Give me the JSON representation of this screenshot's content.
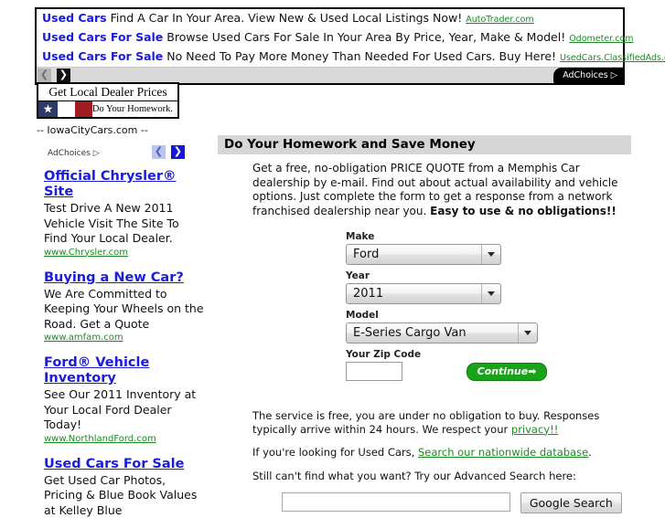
{
  "top_ads": {
    "lines": [
      {
        "title": "Used Cars",
        "text": "Find A Car In Your Area. View New & Used Local Listings Now!",
        "url": "AutoTrader.com"
      },
      {
        "title": "Used Cars For Sale",
        "text": "Browse Used Cars For Sale In Your Area By Price, Year, Make & Model!",
        "url": "Odometer.com"
      },
      {
        "title": "Used Cars For Sale",
        "text": "No Need To Pay More Money Than Needed For Used Cars. Buy Here!",
        "url": "UsedCars.ClassifiedAds.com"
      }
    ],
    "prev_label": "❮",
    "next_label": "❯",
    "adchoices_label": "AdChoices ▷"
  },
  "sidebar": {
    "banner": {
      "title": "Get Local Dealer Prices",
      "tagline": "Do Your Homework.",
      "star": "★"
    },
    "site_name": "-- IowaCityCars.com --",
    "adchoices_label": "AdChoices ▷",
    "prev_label": "❮",
    "next_label": "❯",
    "ads": [
      {
        "title": "Official Chrysler® Site",
        "desc": "Test Drive A New 2011 Vehicle Visit The Site To Find Your Local Dealer.",
        "url": "www.Chrysler.com"
      },
      {
        "title": "Buying a New Car?",
        "desc": "We Are Committed to Keeping Your Wheels on the Road. Get a Quote",
        "url": "www.amfam.com"
      },
      {
        "title": "Ford® Vehicle Inventory",
        "desc": "See Our 2011 Inventory at Your Local Ford Dealer Today!",
        "url": "www.NorthlandFord.com"
      },
      {
        "title": "Used Cars For Sale",
        "desc": "Get Used Car Photos, Pricing & Blue Book Values at Kelley Blue",
        "url": ""
      }
    ]
  },
  "main": {
    "header": "Do Your Homework and Save Money",
    "intro_plain": "Get a free, no-obligation PRICE QUOTE from a Memphis Car dealership by e-mail. Find out about actual availability and vehicle options. Just complete the form to get a response from a network franchised dealership near you. ",
    "intro_bold": "Easy to use & no obligations!!",
    "form": {
      "make_label": "Make",
      "make_value": "Ford",
      "year_label": "Year",
      "year_value": "2011",
      "model_label": "Model",
      "model_value": "E-Series Cargo Van",
      "zip_label": "Your Zip Code",
      "zip_value": "",
      "continue_label": "Continue",
      "continue_arrow": "➡"
    },
    "footnotes": {
      "line1_a": "The service is free, you are under no obligation to buy. Responses typically arrive within 24 hours. We respect your ",
      "line1_link": "privacy!!",
      "line2_a": "If you're looking for Used Cars, ",
      "line2_link": "Search our nationwide database",
      "line2_b": ".",
      "line3": "Still can't find what you want? Try our Advanced Search here:"
    },
    "search": {
      "value": "",
      "placeholder": "",
      "button_label": "Google Search"
    }
  }
}
